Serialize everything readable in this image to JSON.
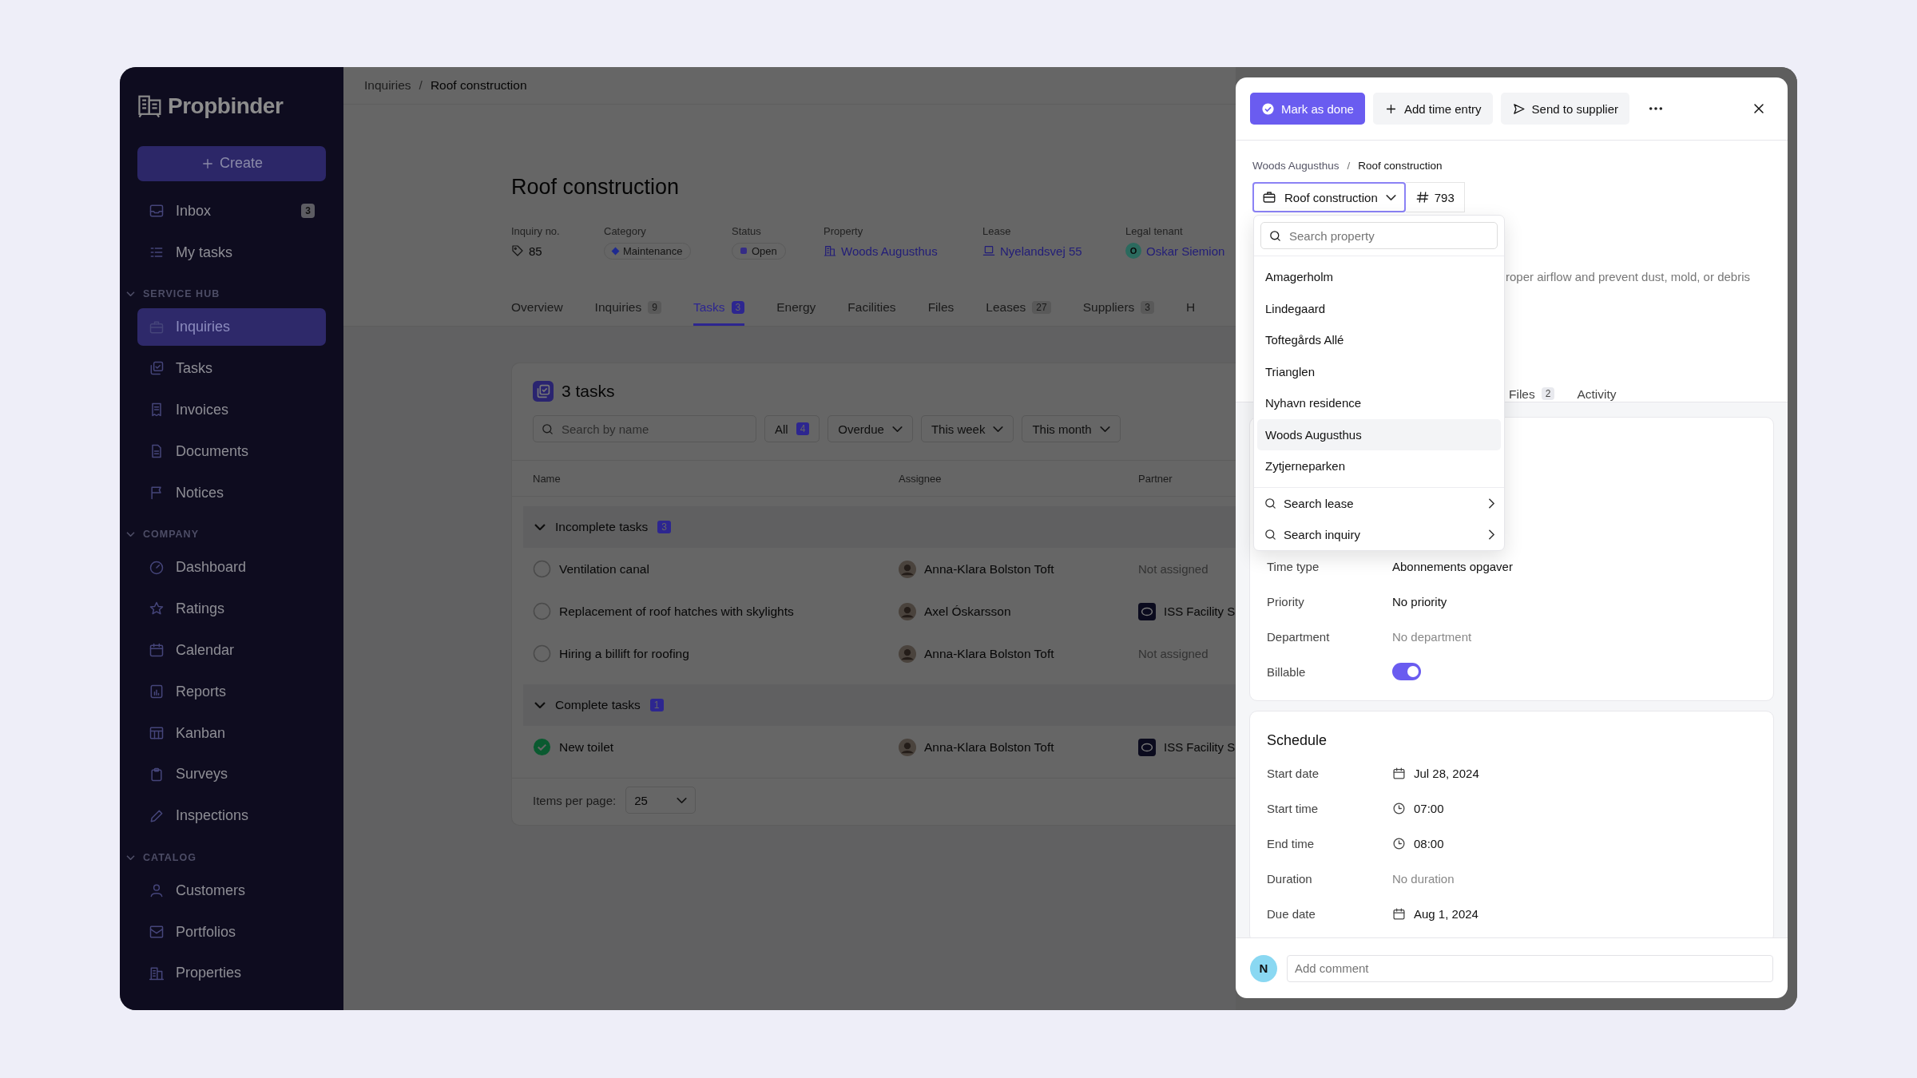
{
  "sidebar": {
    "logo": "Propbinder",
    "create_button": "Create",
    "items": [
      {
        "label": "Inbox",
        "badge": "3",
        "selected": false
      },
      {
        "label": "My tasks",
        "selected": false
      }
    ],
    "sections": [
      {
        "title": "SERVICE HUB",
        "expanded": true,
        "items": [
          {
            "label": "Inquiries",
            "selected": true
          },
          {
            "label": "Tasks",
            "selected": false
          },
          {
            "label": "Invoices",
            "selected": false
          },
          {
            "label": "Documents",
            "selected": false
          },
          {
            "label": "Notices",
            "selected": false
          }
        ]
      },
      {
        "title": "COMPANY",
        "expanded": true,
        "items": [
          {
            "label": "Dashboard",
            "selected": false
          },
          {
            "label": "Ratings",
            "selected": false
          },
          {
            "label": "Calendar",
            "selected": false
          },
          {
            "label": "Reports",
            "selected": false
          },
          {
            "label": "Kanban",
            "selected": false
          },
          {
            "label": "Surveys",
            "selected": false
          },
          {
            "label": "Inspections",
            "selected": false
          }
        ]
      },
      {
        "title": "CATALOG",
        "expanded": true,
        "items": [
          {
            "label": "Customers",
            "selected": false
          },
          {
            "label": "Portfolios",
            "selected": false
          },
          {
            "label": "Properties",
            "selected": false
          }
        ]
      }
    ]
  },
  "breadcrumb": {
    "separator": "/",
    "items": [
      "Inquiries",
      "Roof construction"
    ]
  },
  "inquiry": {
    "title": "Roof construction",
    "fields": [
      {
        "kind": "number",
        "label": "Inquiry no.",
        "value": "85"
      },
      {
        "kind": "pill",
        "label": "Category",
        "value": "Maintenance",
        "color": "#1e2a90"
      },
      {
        "kind": "pill",
        "label": "Status",
        "value": "Open",
        "color": "#352c86"
      },
      {
        "kind": "property",
        "label": "Property",
        "value": "Woods Augusthus"
      },
      {
        "kind": "lease",
        "label": "Lease",
        "value": "Nyelandsvej 55"
      },
      {
        "kind": "tenant",
        "label": "Legal tenant",
        "value": "Oskar Siemion",
        "initial": "O"
      }
    ]
  },
  "tabs": [
    {
      "label": "Overview",
      "selected": false
    },
    {
      "label": "Inquiries",
      "count": "9",
      "selected": false
    },
    {
      "label": "Tasks",
      "count": "3",
      "selected": true
    },
    {
      "label": "Energy",
      "selected": false
    },
    {
      "label": "Facilities",
      "selected": false
    },
    {
      "label": "Files",
      "selected": false
    },
    {
      "label": "Leases",
      "count": "27",
      "selected": false
    },
    {
      "label": "Suppliers",
      "count": "3",
      "selected": false
    },
    {
      "label": "H",
      "selected": false
    }
  ],
  "tasks": {
    "title": "3 tasks",
    "search": {
      "placeholder": "Search by name"
    },
    "filters": [
      {
        "kind": "count",
        "label": "All",
        "count": "4"
      },
      {
        "kind": "dropdown",
        "label": "Overdue"
      },
      {
        "kind": "dropdown",
        "label": "This week"
      },
      {
        "kind": "dropdown",
        "label": "This month"
      }
    ],
    "columns": [
      "Name",
      "Assignee",
      "Partner"
    ],
    "groups": [
      {
        "title": "Incomplete tasks",
        "count": "3",
        "expanded": true,
        "rows": [
          {
            "name": "Ventilation canal",
            "done": false,
            "assignee": "Anna-Klara Bolston Toft",
            "partner": {
              "kind": "none",
              "name": "Not assigned"
            }
          },
          {
            "name": "Replacement of roof hatches with skylights",
            "done": false,
            "assignee": "Axel Óskarsson",
            "partner": {
              "kind": "company",
              "name": "ISS Facility S"
            }
          },
          {
            "name": "Hiring a billift for roofing",
            "done": false,
            "assignee": "Anna-Klara Bolston Toft",
            "partner": {
              "kind": "none",
              "name": "Not assigned"
            }
          }
        ]
      },
      {
        "title": "Complete tasks",
        "count": "1",
        "expanded": true,
        "rows": [
          {
            "name": "New toilet",
            "done": true,
            "assignee": "Anna-Klara Bolston Toft",
            "partner": {
              "kind": "company",
              "name": "ISS Facility S"
            }
          }
        ]
      }
    ],
    "pagination": {
      "label": "Items per page:",
      "value": "25"
    }
  },
  "panel": {
    "actions": [
      {
        "kind": "done",
        "label": "Mark as done"
      },
      {
        "kind": "add",
        "label": "Add time entry"
      },
      {
        "kind": "send",
        "label": "Send to supplier"
      }
    ],
    "breadcrumb": {
      "separator": "/",
      "items": [
        "Woods Augusthus",
        "Roof construction"
      ]
    },
    "type_select": {
      "value": "Roof construction",
      "number": "793"
    },
    "description": "roper airflow and prevent dust, mold, or debris",
    "tabs": [
      {
        "label": "Files",
        "count": "2"
      },
      {
        "label": "Activity"
      }
    ],
    "details": [
      {
        "kind": "text",
        "label": "Time type",
        "value": "Abonnements opgaver"
      },
      {
        "kind": "text",
        "label": "Priority",
        "value": "No priority"
      },
      {
        "kind": "empty",
        "label": "Department",
        "value": "No department"
      },
      {
        "kind": "toggle",
        "label": "Billable",
        "on": true
      }
    ],
    "schedule": {
      "title": "Schedule",
      "rows": [
        {
          "kind": "date",
          "label": "Start date",
          "value": "Jul 28, 2024"
        },
        {
          "kind": "time",
          "label": "Start time",
          "value": "07:00"
        },
        {
          "kind": "time",
          "label": "End time",
          "value": "08:00"
        },
        {
          "kind": "empty",
          "label": "Duration",
          "value": "No duration"
        },
        {
          "kind": "date",
          "label": "Due date",
          "value": "Aug 1, 2024"
        }
      ]
    },
    "comment": {
      "avatar": "N",
      "placeholder": "Add comment"
    },
    "dropdown": {
      "search": {
        "placeholder": "Search property"
      },
      "options": [
        {
          "label": "Amagerholm",
          "selected": false
        },
        {
          "label": "Lindegaard",
          "selected": false
        },
        {
          "label": "Toftegårds Allé",
          "selected": false
        },
        {
          "label": "Trianglen",
          "selected": false
        },
        {
          "label": "Nyhavn residence",
          "selected": false
        },
        {
          "label": "Woods Augusthus",
          "selected": true
        },
        {
          "label": "Zytjerneparken",
          "selected": false
        }
      ],
      "links": [
        "Search lease",
        "Search inquiry"
      ]
    }
  }
}
